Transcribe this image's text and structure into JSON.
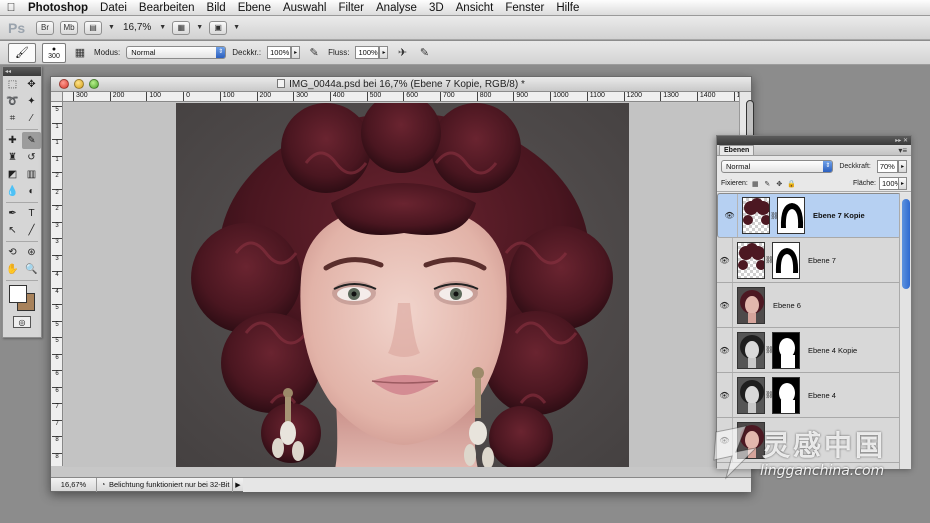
{
  "menubar": {
    "apple": "",
    "items": [
      "Photoshop",
      "Datei",
      "Bearbeiten",
      "Bild",
      "Ebene",
      "Auswahl",
      "Filter",
      "Analyse",
      "3D",
      "Ansicht",
      "Fenster",
      "Hilfe"
    ]
  },
  "appbar": {
    "logo": "Ps",
    "bridge": "Br",
    "minibridge": "Mb",
    "zoom": "16,7%"
  },
  "options": {
    "brush_size": "300",
    "modus_label": "Modus:",
    "modus_value": "Normal",
    "deckkraft_label": "Deckkr.:",
    "deckkraft_value": "100%",
    "fluss_label": "Fluss:",
    "fluss_value": "100%"
  },
  "document": {
    "title": "IMG_0044a.psd bei 16,7% (Ebene 7 Kopie, RGB/8) *",
    "ruler_top": [
      "300",
      "200",
      "100",
      "0",
      "100",
      "200",
      "300",
      "400",
      "500",
      "600",
      "700",
      "800",
      "900",
      "1000",
      "1100",
      "1200",
      "1300",
      "1400",
      "1500",
      "1600"
    ],
    "ruler_left": [
      "5",
      "1",
      "1",
      "1",
      "2",
      "2",
      "2",
      "3",
      "3",
      "3",
      "4",
      "4",
      "5",
      "5",
      "5",
      "6",
      "6",
      "6",
      "7",
      "7",
      "8",
      "8"
    ],
    "status_zoom": "16,67%",
    "status_text": "Belichtung funktioniert nur bei 32-Bit"
  },
  "layers": {
    "tab": "Ebenen",
    "blend": "Normal",
    "deckkraft_label": "Deckkraft:",
    "deckkraft_value": "70%",
    "fixieren_label": "Fixieren:",
    "flaeche_label": "Fläche:",
    "flaeche_value": "100%",
    "items": [
      {
        "name": "Ebene 7 Kopie",
        "selected": true,
        "mask": true,
        "thumb": "hair-mask"
      },
      {
        "name": "Ebene 7",
        "selected": false,
        "mask": true,
        "thumb": "hair-mask"
      },
      {
        "name": "Ebene 6",
        "selected": false,
        "mask": false,
        "thumb": "portrait"
      },
      {
        "name": "Ebene 4 Kopie",
        "selected": false,
        "mask": true,
        "thumb": "bw-portrait"
      },
      {
        "name": "Ebene 4",
        "selected": false,
        "mask": true,
        "thumb": "bw-portrait"
      },
      {
        "name": "",
        "selected": false,
        "mask": false,
        "thumb": "portrait"
      }
    ]
  },
  "watermark": {
    "line1": "灵感中国",
    "line2": "lingganchina.com"
  },
  "colors": {
    "foreground": "#ffffff",
    "background": "#a8825b",
    "selected_layer": "#b6d0f2",
    "hair": "#5a1b24",
    "photo_bg": "#4f4b4b"
  }
}
